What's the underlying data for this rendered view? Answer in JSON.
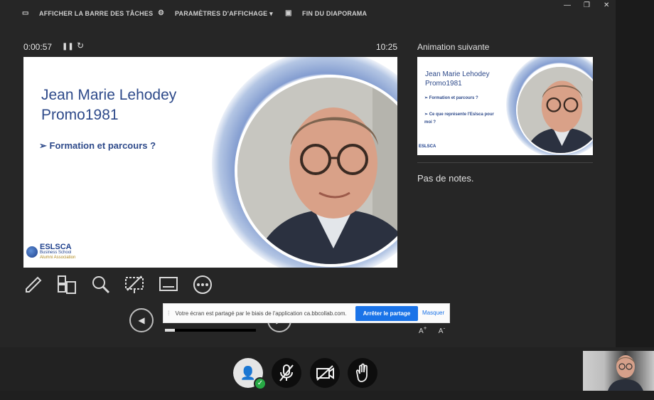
{
  "toolbar": {
    "taskbar_label": "AFFICHER LA BARRE DES TÂCHES",
    "display_settings_label": "PARAMÈTRES D'AFFICHAGE ▾",
    "end_show_label": "FIN DU DIAPORAMA"
  },
  "presenter": {
    "elapsed": "0:00:57",
    "clock": "10:25",
    "next_label": "Animation suivante",
    "notes": "Pas de notes."
  },
  "slide": {
    "title_line1": "Jean Marie Lehodey",
    "title_line2": "Promo1981",
    "bullet1": "Formation et parcours ?",
    "logo_brand": "ESLSCA",
    "logo_sub": "Business School",
    "logo_sub2": "Alumni Association"
  },
  "next_slide": {
    "title_line1": "Jean Marie Lehodey",
    "title_line2": "Promo1981",
    "bullet1": "Formation et parcours ?",
    "bullet2": "Ce que représente l'Eslsca pour moi ?",
    "logo_brand": "ESLSCA"
  },
  "share_banner": {
    "message": "Votre écran est partagé par le biais de l'application ca.bbcollab.com.",
    "stop_label": "Arrêter le partage",
    "hide_label": "Masquer"
  },
  "progress": {
    "fraction": 0.11
  },
  "colors": {
    "accent": "#1a73e8",
    "slide_text": "#2e4a8a",
    "status_ok": "#27a844"
  }
}
